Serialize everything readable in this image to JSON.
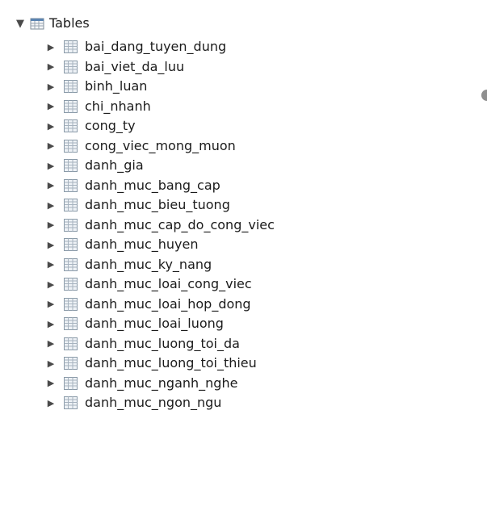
{
  "tree": {
    "root": {
      "label": "Tables",
      "icon": "folder-tables-icon",
      "expanded": true
    },
    "children": [
      {
        "label": "bai_dang_tuyen_dung",
        "icon": "table-icon"
      },
      {
        "label": "bai_viet_da_luu",
        "icon": "table-icon"
      },
      {
        "label": "binh_luan",
        "icon": "table-icon"
      },
      {
        "label": "chi_nhanh",
        "icon": "table-icon"
      },
      {
        "label": "cong_ty",
        "icon": "table-icon"
      },
      {
        "label": "cong_viec_mong_muon",
        "icon": "table-icon"
      },
      {
        "label": "danh_gia",
        "icon": "table-icon"
      },
      {
        "label": "danh_muc_bang_cap",
        "icon": "table-icon"
      },
      {
        "label": "danh_muc_bieu_tuong",
        "icon": "table-icon"
      },
      {
        "label": "danh_muc_cap_do_cong_viec",
        "icon": "table-icon"
      },
      {
        "label": "danh_muc_huyen",
        "icon": "table-icon"
      },
      {
        "label": "danh_muc_ky_nang",
        "icon": "table-icon"
      },
      {
        "label": "danh_muc_loai_cong_viec",
        "icon": "table-icon"
      },
      {
        "label": "danh_muc_loai_hop_dong",
        "icon": "table-icon"
      },
      {
        "label": "danh_muc_loai_luong",
        "icon": "table-icon"
      },
      {
        "label": "danh_muc_luong_toi_da",
        "icon": "table-icon"
      },
      {
        "label": "danh_muc_luong_toi_thieu",
        "icon": "table-icon"
      },
      {
        "label": "danh_muc_nganh_nghe",
        "icon": "table-icon"
      },
      {
        "label": "danh_muc_ngon_ngu",
        "icon": "table-icon"
      }
    ]
  },
  "colors": {
    "text": "#1b1b1b",
    "arrow": "#4a4a4a",
    "icon_border": "#8a9aa8",
    "icon_fill": "#e9eef3",
    "folder_blue": "#5b84b1"
  }
}
